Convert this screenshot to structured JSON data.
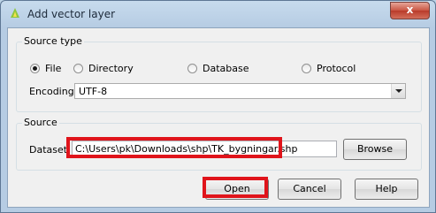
{
  "window": {
    "title": "Add vector layer",
    "close_label": "x"
  },
  "source_type": {
    "group_title": "Source type",
    "options": [
      {
        "label": "File",
        "checked": true
      },
      {
        "label": "Directory",
        "checked": false
      },
      {
        "label": "Database",
        "checked": false
      },
      {
        "label": "Protocol",
        "checked": false
      }
    ],
    "encoding_label": "Encoding",
    "encoding_value": "UTF-8"
  },
  "source": {
    "group_title": "Source",
    "dataset_label": "Dataset",
    "dataset_value": "C:\\Users\\pk\\Downloads\\shp\\TK_bygningar.shp",
    "browse_label": "Browse"
  },
  "buttons": {
    "open": "Open",
    "cancel": "Cancel",
    "help": "Help"
  },
  "colors": {
    "highlight": "#e0141b",
    "title_bar": "#c7dbed"
  }
}
